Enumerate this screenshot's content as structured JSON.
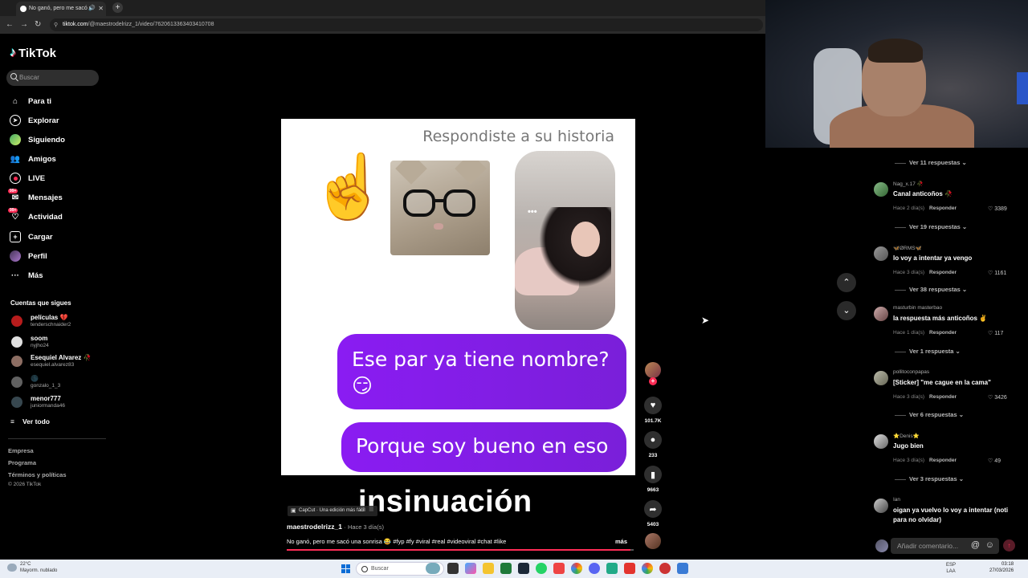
{
  "browser": {
    "tab_title": "No ganó, pero me sacó u",
    "url_host": "tiktok.com",
    "url_path": "/@maestrodelrizz_1/video/7620613363403410708",
    "new_tab": "+"
  },
  "sidebar": {
    "logo": "TikTok",
    "search_placeholder": "Buscar",
    "nav": [
      {
        "label": "Para ti",
        "icon": "home-icon"
      },
      {
        "label": "Explorar",
        "icon": "compass-icon"
      },
      {
        "label": "Siguiendo",
        "icon": "following-icon"
      },
      {
        "label": "Amigos",
        "icon": "friends-icon"
      },
      {
        "label": "LIVE",
        "icon": "live-icon"
      },
      {
        "label": "Mensajes",
        "icon": "messages-icon",
        "badge": "99+"
      },
      {
        "label": "Actividad",
        "icon": "activity-icon",
        "badge": "99+"
      },
      {
        "label": "Cargar",
        "icon": "upload-icon"
      },
      {
        "label": "Perfil",
        "icon": "profile-icon"
      },
      {
        "label": "Más",
        "icon": "more-icon"
      }
    ],
    "following_title": "Cuentas que sigues",
    "following": [
      {
        "name": "películas 💔",
        "handle": "tenderschnaider2",
        "color": "#b71c1c"
      },
      {
        "name": "soom",
        "handle": "nyjho24",
        "color": "#e0e0e0"
      },
      {
        "name": "Esequiel Alvarez 🥀",
        "handle": "esequiel.alvarez83",
        "color": "#8d6e63"
      },
      {
        "name": "🌑",
        "handle": "gonzalo_1_3",
        "color": "#616161"
      },
      {
        "name": "menor777",
        "handle": "juniormanda46",
        "color": "#37474f"
      }
    ],
    "see_all": "Ver todo",
    "footer": [
      "Empresa",
      "Programa",
      "Términos y políticas"
    ],
    "copyright": "© 2026 TikTok"
  },
  "video": {
    "respond_text": "Respondiste a su historia",
    "bubble1": "Ese par ya tiene nombre? 😏",
    "bubble2": "Porque soy bueno en eso",
    "overlay_caption": "insinuación",
    "capcut": "CapCut · Una edición más fácil",
    "author": "maestrodelrizz_1",
    "posted": "· Hace 3 día(s)",
    "description": "No ganó, pero me sacó una sonrisa 😂 #fyp #fy #viral #real #videoviral #chat #like",
    "more": "más",
    "progress": 0.99
  },
  "actions": {
    "likes": "101.7K",
    "comments": "233",
    "saves": "9663",
    "shares": "5403"
  },
  "comments": {
    "view_more": [
      {
        "label": "Ver 11 respuestas ⌄"
      },
      {
        "label": "Ver 19 respuestas ⌄"
      },
      {
        "label": "Ver 38 respuestas ⌄"
      },
      {
        "label": "Ver 1 respuesta ⌄"
      },
      {
        "label": "Ver 6 respuestas ⌄"
      },
      {
        "label": "Ver 3 respuestas ⌄"
      }
    ],
    "items": [
      {
        "user": "Nag_x.17 🥀",
        "text": "Canal anticoños 🥀",
        "time": "Hace 2 día(s)",
        "reply": "Responder",
        "likes": "♡ 3389"
      },
      {
        "user": "🦋ØRMS🦋",
        "text": "lo voy a intentar ya vengo",
        "time": "Hace 3 día(s)",
        "reply": "Responder",
        "likes": "♡ 1161"
      },
      {
        "user": "masturbin masterbao",
        "text": "la respuesta más anticoños ✌️",
        "time": "Hace 1 día(s)",
        "reply": "Responder",
        "likes": "♡ 117"
      },
      {
        "user": "pollitoconpapas",
        "text": "[Sticker] \"me cague en la cama\"",
        "time": "Hace 3 día(s)",
        "reply": "Responder",
        "likes": "♡ 3426"
      },
      {
        "user": "⭐Denis⭐",
        "text": "Jugo bien",
        "time": "Hace 3 día(s)",
        "reply": "Responder",
        "likes": "♡ 49"
      },
      {
        "user": "Ian",
        "text": "oigan ya vuelvo lo voy a intentar (noti para no olvidar)",
        "time": "",
        "reply": "",
        "likes": ""
      }
    ],
    "input_placeholder": "Añadir comentario...",
    "at_symbol": "@",
    "emoji_symbol": "☺",
    "post_symbol": "↑"
  },
  "taskbar": {
    "weather_temp": "22°C",
    "weather_desc": "Mayorm. nublado",
    "search": "Buscar",
    "tray_lang": "ESP",
    "tray_region": "LAA",
    "time": "03:18",
    "date": "27/03/2026"
  }
}
